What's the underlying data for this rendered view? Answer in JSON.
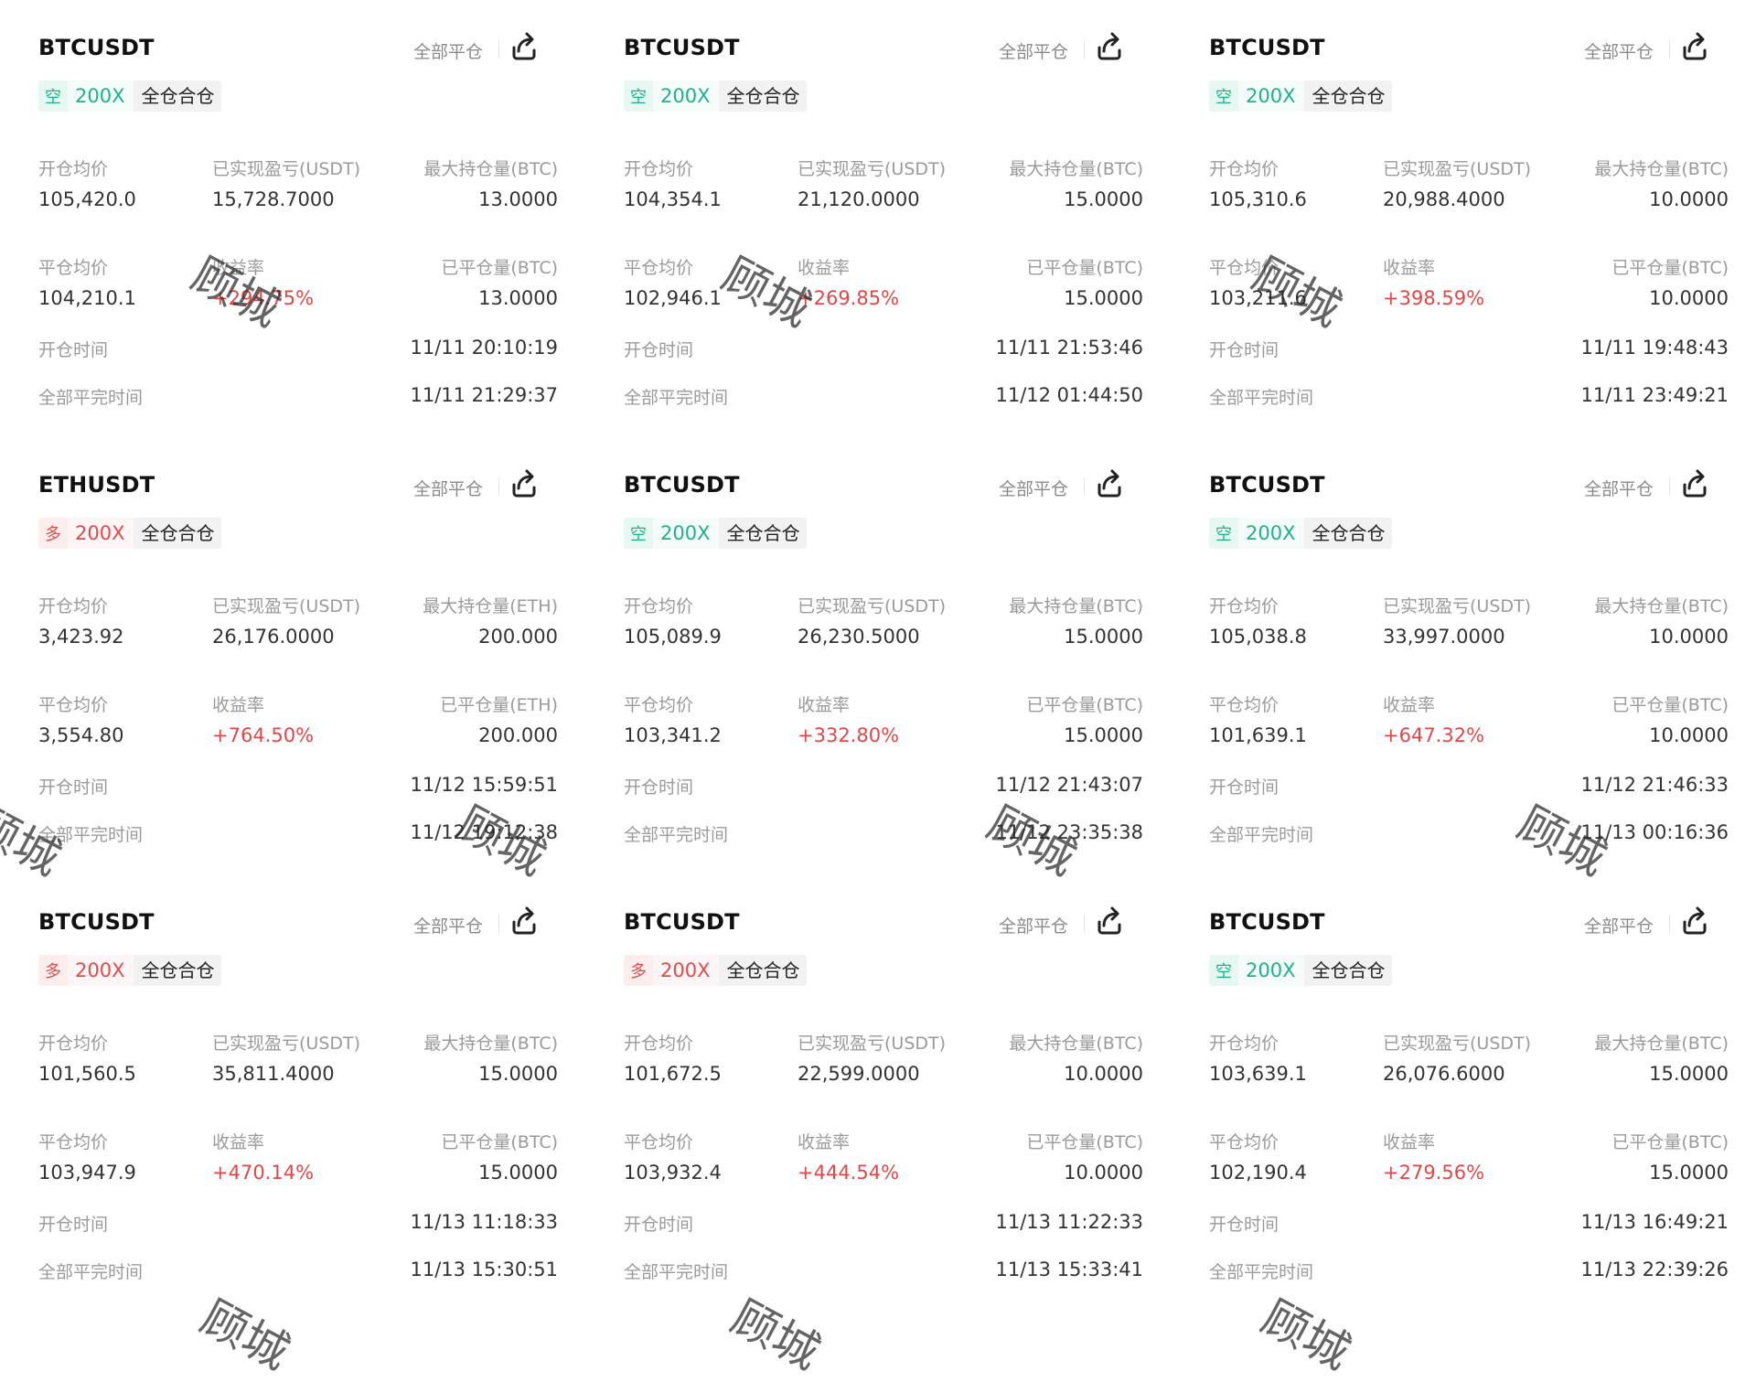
{
  "cards": [
    {
      "symbol": "BTCUSDT",
      "close_all": "全部平仓",
      "direction": "空",
      "dir_type": "short",
      "leverage": "200X",
      "mode": "全仓合仓",
      "labels": {
        "open_avg": "开仓均价",
        "realized_pnl": "已实现盈亏(USDT)",
        "max_pos": "最大持仓量(BTC)",
        "close_avg": "平仓均价",
        "roi": "收益率",
        "closed_qty": "已平仓量(BTC)",
        "open_time": "开仓时间",
        "close_time": "全部平完时间"
      },
      "open_avg": "105,420.0",
      "realized_pnl": "15,728.7000",
      "max_pos": "13.0000",
      "close_avg": "104,210.1",
      "roi": "+294.75%",
      "closed_qty": "13.0000",
      "open_time": "11/11 20:10:19",
      "close_time": "11/11 21:29:37"
    },
    {
      "symbol": "BTCUSDT",
      "close_all": "全部平仓",
      "direction": "空",
      "dir_type": "short",
      "leverage": "200X",
      "mode": "全仓合仓",
      "labels": {
        "open_avg": "开仓均价",
        "realized_pnl": "已实现盈亏(USDT)",
        "max_pos": "最大持仓量(BTC)",
        "close_avg": "平仓均价",
        "roi": "收益率",
        "closed_qty": "已平仓量(BTC)",
        "open_time": "开仓时间",
        "close_time": "全部平完时间"
      },
      "open_avg": "104,354.1",
      "realized_pnl": "21,120.0000",
      "max_pos": "15.0000",
      "close_avg": "102,946.1",
      "roi": "+269.85%",
      "closed_qty": "15.0000",
      "open_time": "11/11 21:53:46",
      "close_time": "11/12 01:44:50"
    },
    {
      "symbol": "BTCUSDT",
      "close_all": "全部平仓",
      "direction": "空",
      "dir_type": "short",
      "leverage": "200X",
      "mode": "全仓合仓",
      "labels": {
        "open_avg": "开仓均价",
        "realized_pnl": "已实现盈亏(USDT)",
        "max_pos": "最大持仓量(BTC)",
        "close_avg": "平仓均价",
        "roi": "收益率",
        "closed_qty": "已平仓量(BTC)",
        "open_time": "开仓时间",
        "close_time": "全部平完时间"
      },
      "open_avg": "105,310.6",
      "realized_pnl": "20,988.4000",
      "max_pos": "10.0000",
      "close_avg": "103,211.6",
      "roi": "+398.59%",
      "closed_qty": "10.0000",
      "open_time": "11/11 19:48:43",
      "close_time": "11/11 23:49:21"
    },
    {
      "symbol": "ETHUSDT",
      "close_all": "全部平仓",
      "direction": "多",
      "dir_type": "long",
      "leverage": "200X",
      "mode": "全仓合仓",
      "labels": {
        "open_avg": "开仓均价",
        "realized_pnl": "已实现盈亏(USDT)",
        "max_pos": "最大持仓量(ETH)",
        "close_avg": "平仓均价",
        "roi": "收益率",
        "closed_qty": "已平仓量(ETH)",
        "open_time": "开仓时间",
        "close_time": "全部平完时间"
      },
      "open_avg": "3,423.92",
      "realized_pnl": "26,176.0000",
      "max_pos": "200.000",
      "close_avg": "3,554.80",
      "roi": "+764.50%",
      "closed_qty": "200.000",
      "open_time": "11/12 15:59:51",
      "close_time": "11/12 19:12:38"
    },
    {
      "symbol": "BTCUSDT",
      "close_all": "全部平仓",
      "direction": "空",
      "dir_type": "short",
      "leverage": "200X",
      "mode": "全仓合仓",
      "labels": {
        "open_avg": "开仓均价",
        "realized_pnl": "已实现盈亏(USDT)",
        "max_pos": "最大持仓量(BTC)",
        "close_avg": "平仓均价",
        "roi": "收益率",
        "closed_qty": "已平仓量(BTC)",
        "open_time": "开仓时间",
        "close_time": "全部平完时间"
      },
      "open_avg": "105,089.9",
      "realized_pnl": "26,230.5000",
      "max_pos": "15.0000",
      "close_avg": "103,341.2",
      "roi": "+332.80%",
      "closed_qty": "15.0000",
      "open_time": "11/12 21:43:07",
      "close_time": "11/12 23:35:38"
    },
    {
      "symbol": "BTCUSDT",
      "close_all": "全部平仓",
      "direction": "空",
      "dir_type": "short",
      "leverage": "200X",
      "mode": "全仓合仓",
      "labels": {
        "open_avg": "开仓均价",
        "realized_pnl": "已实现盈亏(USDT)",
        "max_pos": "最大持仓量(BTC)",
        "close_avg": "平仓均价",
        "roi": "收益率",
        "closed_qty": "已平仓量(BTC)",
        "open_time": "开仓时间",
        "close_time": "全部平完时间"
      },
      "open_avg": "105,038.8",
      "realized_pnl": "33,997.0000",
      "max_pos": "10.0000",
      "close_avg": "101,639.1",
      "roi": "+647.32%",
      "closed_qty": "10.0000",
      "open_time": "11/12 21:46:33",
      "close_time": "11/13 00:16:36"
    },
    {
      "symbol": "BTCUSDT",
      "close_all": "全部平仓",
      "direction": "多",
      "dir_type": "long",
      "leverage": "200X",
      "mode": "全仓合仓",
      "labels": {
        "open_avg": "开仓均价",
        "realized_pnl": "已实现盈亏(USDT)",
        "max_pos": "最大持仓量(BTC)",
        "close_avg": "平仓均价",
        "roi": "收益率",
        "closed_qty": "已平仓量(BTC)",
        "open_time": "开仓时间",
        "close_time": "全部平完时间"
      },
      "open_avg": "101,560.5",
      "realized_pnl": "35,811.4000",
      "max_pos": "15.0000",
      "close_avg": "103,947.9",
      "roi": "+470.14%",
      "closed_qty": "15.0000",
      "open_time": "11/13 11:18:33",
      "close_time": "11/13 15:30:51"
    },
    {
      "symbol": "BTCUSDT",
      "close_all": "全部平仓",
      "direction": "多",
      "dir_type": "long",
      "leverage": "200X",
      "mode": "全仓合仓",
      "labels": {
        "open_avg": "开仓均价",
        "realized_pnl": "已实现盈亏(USDT)",
        "max_pos": "最大持仓量(BTC)",
        "close_avg": "平仓均价",
        "roi": "收益率",
        "closed_qty": "已平仓量(BTC)",
        "open_time": "开仓时间",
        "close_time": "全部平完时间"
      },
      "open_avg": "101,672.5",
      "realized_pnl": "22,599.0000",
      "max_pos": "10.0000",
      "close_avg": "103,932.4",
      "roi": "+444.54%",
      "closed_qty": "10.0000",
      "open_time": "11/13 11:22:33",
      "close_time": "11/13 15:33:41"
    },
    {
      "symbol": "BTCUSDT",
      "close_all": "全部平仓",
      "direction": "空",
      "dir_type": "short",
      "leverage": "200X",
      "mode": "全仓合仓",
      "labels": {
        "open_avg": "开仓均价",
        "realized_pnl": "已实现盈亏(USDT)",
        "max_pos": "最大持仓量(BTC)",
        "close_avg": "平仓均价",
        "roi": "收益率",
        "closed_qty": "已平仓量(BTC)",
        "open_time": "开仓时间",
        "close_time": "全部平完时间"
      },
      "open_avg": "103,639.1",
      "realized_pnl": "26,076.6000",
      "max_pos": "15.0000",
      "close_avg": "102,190.4",
      "roi": "+279.56%",
      "closed_qty": "15.0000",
      "open_time": "11/13 16:49:21",
      "close_time": "11/13 22:39:26"
    }
  ],
  "watermark": {
    "text": "顾城"
  },
  "colors": {
    "short": "#1eb48a",
    "long": "#e24b4b",
    "profit": "#e04848"
  }
}
